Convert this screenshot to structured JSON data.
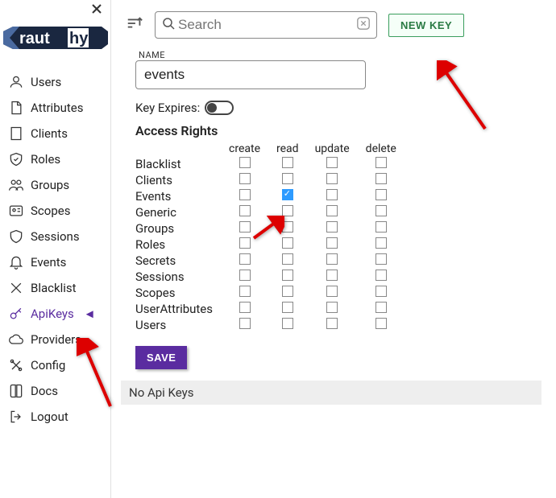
{
  "app": {
    "name": "rauthy"
  },
  "sidebar": {
    "items": [
      {
        "label": "Users",
        "icon": "user-icon"
      },
      {
        "label": "Attributes",
        "icon": "file-icon"
      },
      {
        "label": "Clients",
        "icon": "building-icon"
      },
      {
        "label": "Roles",
        "icon": "shield-check-icon"
      },
      {
        "label": "Groups",
        "icon": "users-icon"
      },
      {
        "label": "Scopes",
        "icon": "id-icon"
      },
      {
        "label": "Sessions",
        "icon": "shield-icon"
      },
      {
        "label": "Events",
        "icon": "bell-icon"
      },
      {
        "label": "Blacklist",
        "icon": "x-icon"
      },
      {
        "label": "ApiKeys",
        "icon": "key-icon",
        "active": true
      },
      {
        "label": "Providers",
        "icon": "cloud-icon"
      },
      {
        "label": "Config",
        "icon": "tools-icon"
      },
      {
        "label": "Docs",
        "icon": "book-icon"
      },
      {
        "label": "Logout",
        "icon": "logout-icon"
      }
    ]
  },
  "topbar": {
    "search_placeholder": "Search",
    "new_key_label": "NEW KEY"
  },
  "form": {
    "name_label": "NAME",
    "name_value": "events",
    "expires_label": "Key Expires:",
    "expires_on": false,
    "rights_title": "Access Rights",
    "columns": [
      "create",
      "read",
      "update",
      "delete"
    ],
    "rows": [
      {
        "name": "Blacklist",
        "perms": [
          false,
          false,
          false,
          false
        ]
      },
      {
        "name": "Clients",
        "perms": [
          false,
          false,
          false,
          false
        ]
      },
      {
        "name": "Events",
        "perms": [
          false,
          true,
          false,
          false
        ]
      },
      {
        "name": "Generic",
        "perms": [
          false,
          false,
          false,
          false
        ]
      },
      {
        "name": "Groups",
        "perms": [
          false,
          false,
          false,
          false
        ]
      },
      {
        "name": "Roles",
        "perms": [
          false,
          false,
          false,
          false
        ]
      },
      {
        "name": "Secrets",
        "perms": [
          false,
          false,
          false,
          false
        ]
      },
      {
        "name": "Sessions",
        "perms": [
          false,
          false,
          false,
          false
        ]
      },
      {
        "name": "Scopes",
        "perms": [
          false,
          false,
          false,
          false
        ]
      },
      {
        "name": "UserAttributes",
        "perms": [
          false,
          false,
          false,
          false
        ]
      },
      {
        "name": "Users",
        "perms": [
          false,
          false,
          false,
          false
        ]
      }
    ],
    "save_label": "SAVE"
  },
  "status": {
    "no_keys": "No Api Keys"
  }
}
